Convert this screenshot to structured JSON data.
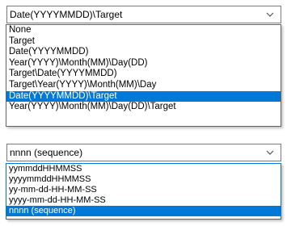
{
  "combo1": {
    "value": "Date(YYYYMMDD)\\Target",
    "items": [
      "None",
      "Target",
      "Date(YYYYMMDD)",
      "Year(YYYY)\\Month(MM)\\Day(DD)",
      "Target\\Date(YYYYMMDD)",
      "Target\\Year(YYYY)\\Month(MM)\\Day",
      "Date(YYYYMMDD)\\Target",
      "Year(YYYY)\\Month(MM)\\Day(DD)\\Target"
    ],
    "selected_index": 6
  },
  "combo2": {
    "value": "nnnn (sequence)",
    "items": [
      "yymmddHHMMSS",
      "yyyymmddHHMMSS",
      "yy-mm-dd-HH-MM-SS",
      "yyyy-mm-dd-HH-MM-SS",
      "nnnn (sequence)"
    ],
    "selected_index": 4
  },
  "colors": {
    "selection": "#0078d7",
    "selection_text": "#ffffff"
  },
  "icons": {
    "dropdown": "chevron-down-icon"
  }
}
